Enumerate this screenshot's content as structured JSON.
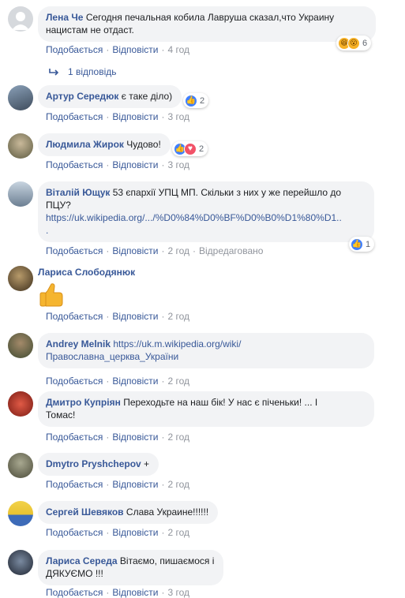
{
  "labels": {
    "like": "Подобається",
    "reply": "Відповісти",
    "edited": "Відредаговано",
    "sep": "·"
  },
  "comments": [
    {
      "author": "Лена Че",
      "text": "Сегодня печальная кобила Лавруша сказал,что Украину нацистам не отдаст.",
      "time": "4 год",
      "reactions": {
        "types": [
          "haha",
          "wow"
        ],
        "count": "6"
      },
      "replies_label": "1 відповідь",
      "avatar_color": "#d6d9dd"
    },
    {
      "author": "Артур Середюк",
      "text": "є таке діло)",
      "time": "3 год",
      "reactions": {
        "types": [
          "like"
        ],
        "count": "2"
      },
      "avatar_color": "#5b6b7c"
    },
    {
      "author": "Людмила Жирок",
      "text": "Чудово!",
      "time": "3 год",
      "reactions": {
        "types": [
          "like",
          "love"
        ],
        "count": "2"
      },
      "avatar_color": "#7a7a5c"
    },
    {
      "author": "Віталій Ющук",
      "text": "53 єпархії УПЦ МП. Скільки з них у же перейшло до ПЦУ?",
      "link": "https://uk.wikipedia.org/.../%D0%84%D0%BF%D0%B0%D1%80%D1..",
      "link_tail": ".",
      "time": "2 год",
      "edited": true,
      "reactions": {
        "types": [
          "like"
        ],
        "count": "1"
      },
      "avatar_color": "#8fa3b8"
    },
    {
      "author": "Лариса Слободянюк",
      "sticker": "thumbs-up",
      "time": "2 год",
      "avatar_color": "#6a5a3c"
    },
    {
      "author": "Andrey Melnik",
      "link": "https://uk.m.wikipedia.org/wiki/",
      "link2": "Православна_церква_України",
      "time": "2 год",
      "avatar_color": "#4e5a3e"
    },
    {
      "author": "Дмитро Купріян",
      "text": "Переходьте на наш бік! У нас є піченьки! ... І",
      "text2": "Томас!",
      "time": "2 год",
      "avatar_color": "#b03a2e"
    },
    {
      "author": "Dmytro Pryshchepov",
      "text": "+",
      "time": "2 год",
      "avatar_color": "#6d6e5a"
    },
    {
      "author": "Сергей Шевяков",
      "text": "Слава Украине!!!!!!",
      "time": "2 год",
      "avatar_color": "#e0c23a"
    },
    {
      "author": "Лариса Середа",
      "text": "Вітаємо, пишаємося і",
      "text2": "ДЯКУЄМО !!!",
      "time": "3 год",
      "avatar_color": "#2c3340"
    }
  ],
  "colors": {
    "author": "#385898",
    "bubble": "#f2f3f5",
    "meta": "#90949c",
    "like": "#4080ff",
    "love": "#f25268"
  }
}
